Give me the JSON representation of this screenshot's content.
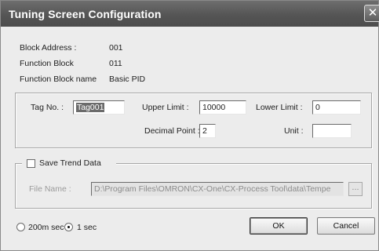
{
  "window": {
    "title": "Tuning Screen Configuration",
    "close_glyph": "✕"
  },
  "info": {
    "block_address_label": "Block Address :",
    "block_address_value": "001",
    "function_block_label": "Function Block",
    "function_block_value": "011",
    "function_block_name_label": "Function Block name",
    "function_block_name_value": "Basic PID"
  },
  "params": {
    "tag_label": "Tag No. :",
    "tag_value": "Tag001",
    "upper_label": "Upper Limit :",
    "upper_value": "10000",
    "lower_label": "Lower Limit :",
    "lower_value": "0",
    "decimal_label": "Decimal Point :",
    "decimal_value": "2",
    "unit_label": "Unit :",
    "unit_value": ""
  },
  "trend": {
    "save_label": "Save Trend Data",
    "save_checked": false,
    "file_label": "File Name :",
    "file_value": "D:\\Program Files\\OMRON\\CX-One\\CX-Process Tool\\data\\Tempe",
    "browse_label": "..."
  },
  "interval": {
    "option_200ms": "200m sec",
    "option_1s": "1 sec",
    "selected": "1 sec"
  },
  "buttons": {
    "ok": "OK",
    "cancel": "Cancel"
  }
}
